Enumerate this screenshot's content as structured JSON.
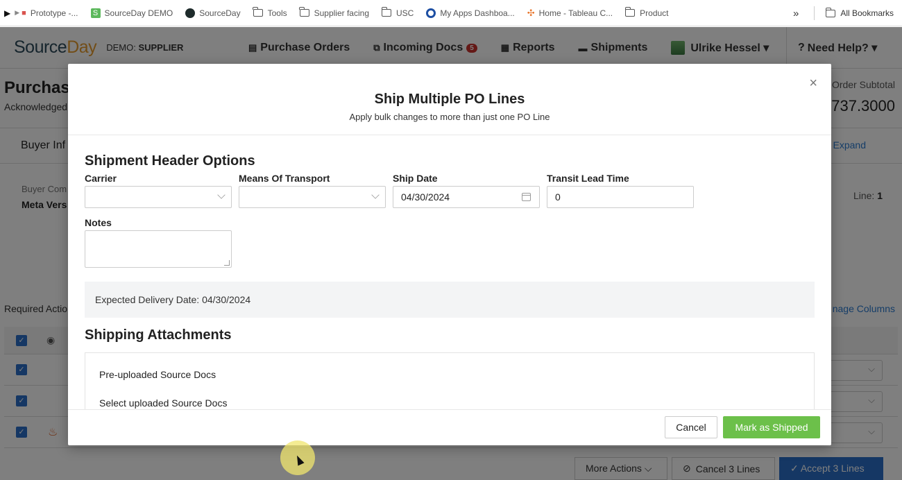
{
  "bookmarks": {
    "items": [
      {
        "label": "Prototype -..."
      },
      {
        "label": "SourceDay DEMO"
      },
      {
        "label": "SourceDay"
      },
      {
        "label": "Tools"
      },
      {
        "label": "Supplier facing"
      },
      {
        "label": "USC"
      },
      {
        "label": "My Apps Dashboa..."
      },
      {
        "label": "Home - Tableau C..."
      },
      {
        "label": "Product"
      }
    ],
    "more": "»",
    "all": "All Bookmarks"
  },
  "nav": {
    "logo_main": "Source",
    "logo_accent": "Day",
    "env_prefix": "DEMO:",
    "env_name": "SUPPLIER",
    "purchase_orders": "Purchase Orders",
    "incoming_docs": "Incoming Docs",
    "incoming_count": "5",
    "reports": "Reports",
    "shipments": "Shipments",
    "user": "Ulrike Hessel ▾",
    "help": "Need Help? ▾"
  },
  "background": {
    "title": "Purchase",
    "status": "Acknowledged",
    "subtotal_label": "Order Subtotal",
    "subtotal": ".737.3000",
    "buyer_section": "Buyer Inf",
    "expand": "Expand",
    "buyer_company_label": "Buyer Com",
    "buyer_company": "Meta Vers",
    "line_label": "Line:",
    "line_value": "1",
    "required_actions": "Required Actio",
    "manage_columns": "nage Columns",
    "more_actions": "More Actions ⌵",
    "cancel_lines": "Cancel 3 Lines",
    "accept_lines": "✓  Accept 3 Lines"
  },
  "modal": {
    "title": "Ship Multiple PO Lines",
    "subtitle": "Apply bulk changes to more than just one PO Line",
    "close": "×",
    "header_section": "Shipment Header Options",
    "carrier_label": "Carrier",
    "carrier_value": "",
    "means_label": "Means Of Transport",
    "means_value": "",
    "ship_date_label": "Ship Date",
    "ship_date": "04/30/2024",
    "transit_label": "Transit Lead Time",
    "transit_value": "0",
    "notes_label": "Notes",
    "expected_delivery": "Expected Delivery Date: 04/30/2024",
    "attachments_section": "Shipping Attachments",
    "preuploaded": "Pre-uploaded Source Docs",
    "select_uploaded": "Select uploaded Source Docs",
    "cancel": "Cancel",
    "mark_shipped": "Mark as Shipped"
  }
}
